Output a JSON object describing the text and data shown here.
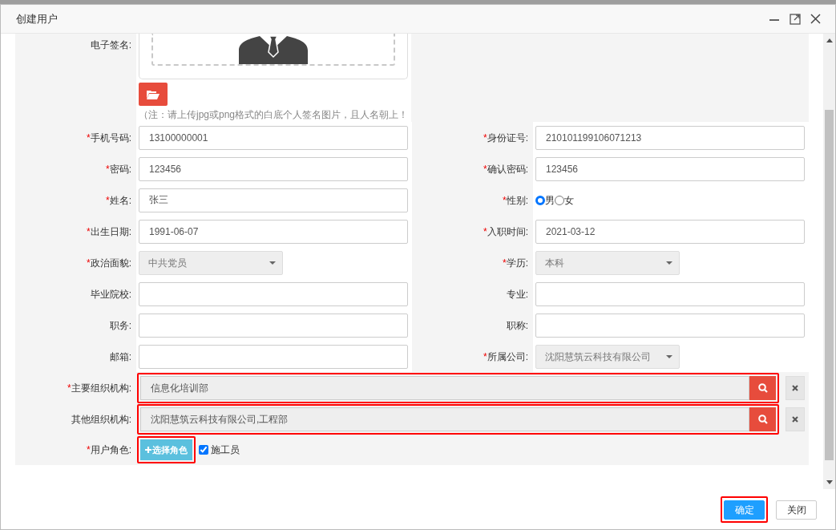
{
  "window": {
    "title": "创建用户"
  },
  "signature": {
    "label": "电子签名:",
    "note": "（注：请上传jpg或png格式的白底个人签名图片，且人名朝上！"
  },
  "rows": [
    {
      "left": {
        "kind": "text",
        "mark": "*",
        "label": "手机号码:",
        "value": "13100000001"
      },
      "right": {
        "kind": "text",
        "mark": "*",
        "label": "身份证号:",
        "value": "210101199106071213"
      }
    },
    {
      "left": {
        "kind": "text",
        "mark": "*",
        "label": "密码:",
        "value": "123456"
      },
      "right": {
        "kind": "text",
        "mark": "*",
        "label": "确认密码:",
        "value": "123456"
      }
    },
    {
      "left": {
        "kind": "text",
        "mark": "*",
        "label": "姓名:",
        "value": "张三"
      },
      "right": {
        "kind": "radio",
        "mark": "*",
        "label": "性别:",
        "options": [
          {
            "label": "男",
            "selected": true
          },
          {
            "label": "女",
            "selected": false
          }
        ]
      }
    },
    {
      "left": {
        "kind": "text",
        "mark": "*",
        "label": "出生日期:",
        "value": "1991-06-07"
      },
      "right": {
        "kind": "text",
        "mark": "*",
        "label": "入职时间:",
        "value": "2021-03-12"
      }
    },
    {
      "left": {
        "kind": "select",
        "mark": "*",
        "label": "政治面貌:",
        "value": "中共党员"
      },
      "right": {
        "kind": "select",
        "mark": "*",
        "label": "学历:",
        "value": "本科"
      }
    },
    {
      "left": {
        "kind": "text",
        "label": "毕业院校:"
      },
      "right": {
        "kind": "text",
        "label": "专业:"
      }
    },
    {
      "left": {
        "kind": "text",
        "label": "职务:"
      },
      "right": {
        "kind": "text",
        "label": "职称:"
      }
    },
    {
      "left": {
        "kind": "text",
        "label": "邮箱:"
      },
      "right": {
        "kind": "select",
        "mark": "*",
        "label": "所属公司:",
        "value": "沈阳慧筑云科技有限公司"
      }
    }
  ],
  "org_pickers": [
    {
      "mark": "*",
      "label": "主要组织机构:",
      "value": "信息化培训部",
      "highlighted": true
    },
    {
      "label": "其他组织机构:",
      "value": "沈阳慧筑云科技有限公司,工程部",
      "highlighted": true
    }
  ],
  "roles": {
    "mark": "*",
    "label": "用户角色:",
    "button": "选择角色",
    "button_highlighted": true,
    "items": [
      {
        "label": "施工员",
        "checked": true
      }
    ]
  },
  "footer": {
    "buttons": [
      {
        "label": "确定",
        "kind": "primary",
        "highlighted": true
      },
      {
        "label": "关闭",
        "kind": "default",
        "highlighted": false
      }
    ]
  }
}
